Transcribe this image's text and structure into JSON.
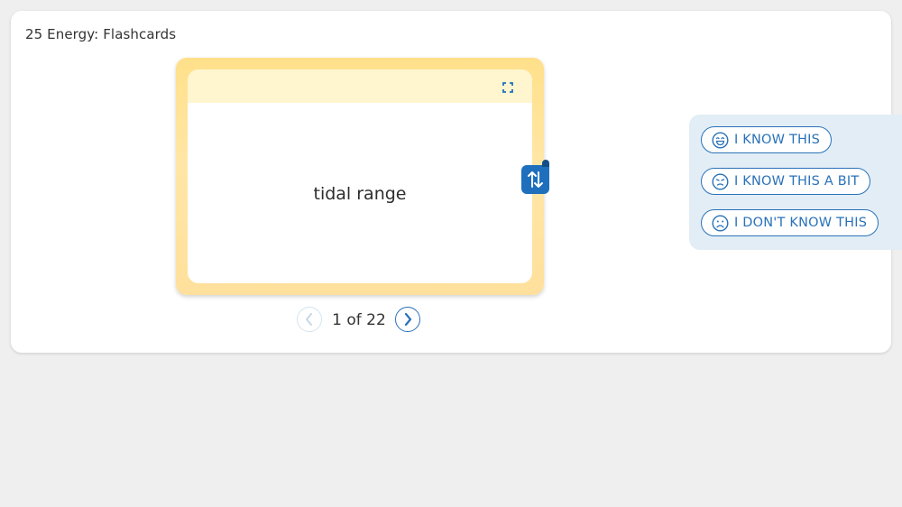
{
  "page": {
    "title": "25 Energy: Flashcards"
  },
  "card": {
    "term": "tidal range"
  },
  "pager": {
    "label": "1 of 22"
  },
  "rating": {
    "know": "I KNOW THIS",
    "know_bit": "I KNOW THIS A BIT",
    "dont_know": "I DON'T KNOW THIS"
  },
  "colors": {
    "accent": "#2a72b8",
    "flip_tab": "#1f6fbd",
    "card_frame": "#ffe08a",
    "card_header": "#fff5cf",
    "rating_panel": "#e2edf6"
  },
  "icons": {
    "expand": "expand-icon",
    "flip": "swap-vertical-icon",
    "prev": "chevron-left-icon",
    "next": "chevron-right-icon",
    "know": "smile-face-icon",
    "know_bit": "neutral-face-icon",
    "dont_know": "sad-face-icon"
  }
}
